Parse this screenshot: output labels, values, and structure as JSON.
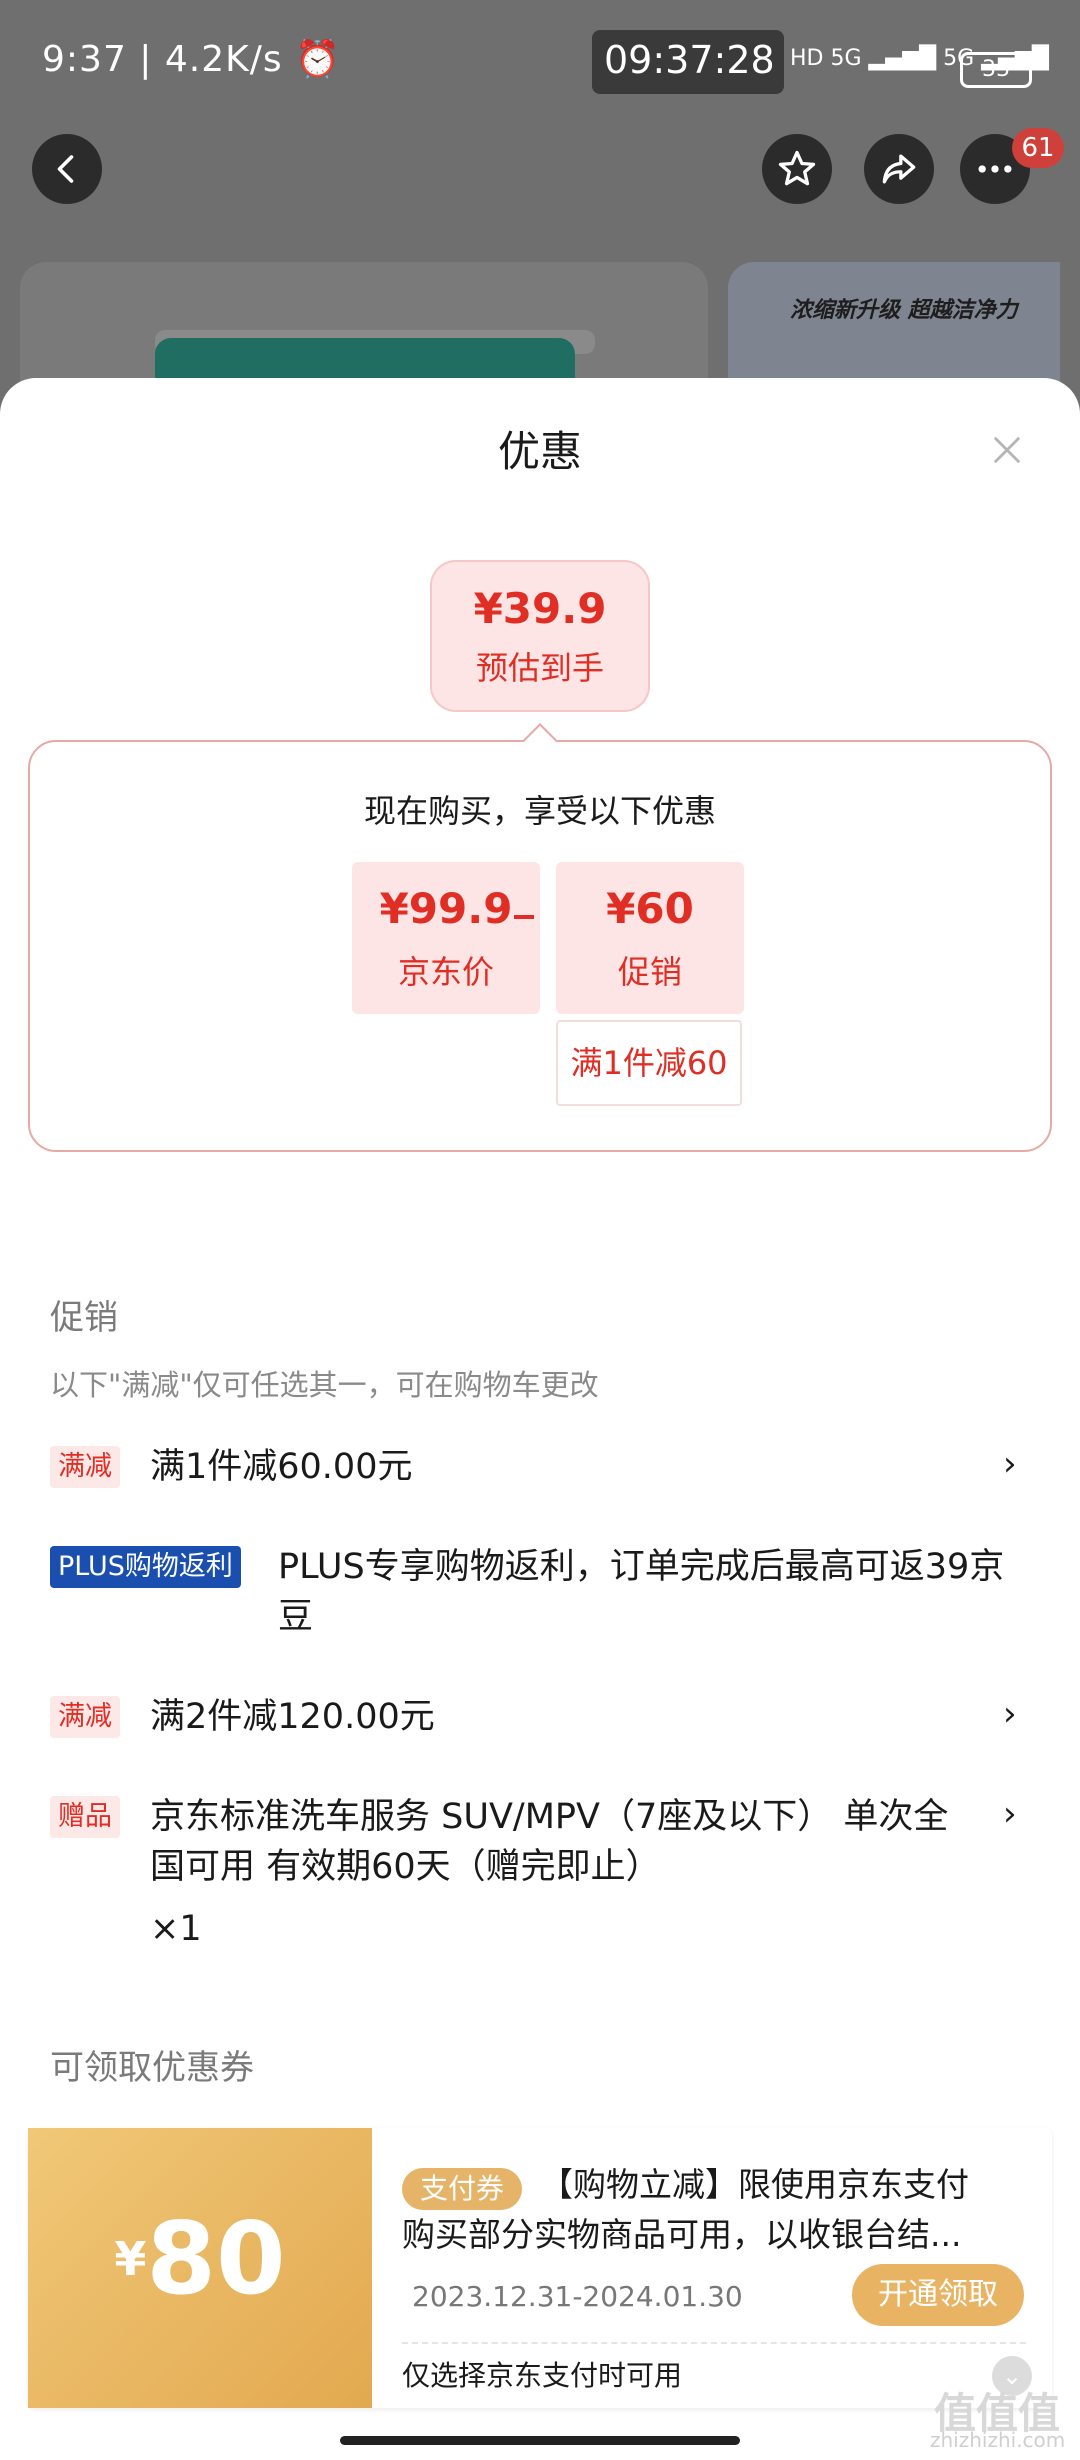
{
  "status_bar": {
    "left": "9:37 | 4.2K/s ⏰",
    "clock": "09:37:28",
    "signals": "HD  5G ▂▄▆█ 5G ▂▄▆█",
    "battery": "33"
  },
  "nav": {
    "notification_count": "61"
  },
  "background": {
    "banner_text": "浓缩新升级 超越洁净力"
  },
  "sheet": {
    "title": "优惠",
    "estimate": {
      "price": "¥39.9",
      "label": "预估到手"
    },
    "breakdown": {
      "heading": "现在购买，享受以下优惠",
      "jd_price": {
        "value": "¥99.9",
        "label": "京东价"
      },
      "promo": {
        "value": "¥60",
        "label": "促销"
      },
      "promo_rule": "满1件减60"
    },
    "promotions": {
      "title": "促销",
      "subtitle": "以下\"满减\"仅可任选其一，可在购物车更改",
      "items": [
        {
          "tag": "满减",
          "text": "满1件减60.00元"
        },
        {
          "tag": "PLUS购物返利",
          "text": "PLUS专享购物返利，订单完成后最高可返39京豆"
        },
        {
          "tag": "满减",
          "text": "满2件减120.00元"
        },
        {
          "tag": "赠品",
          "text": "京东标准洗车服务 SUV/MPV（7座及以下） 单次全国可用 有效期60天（赠完即止）",
          "qty": "×1"
        }
      ]
    },
    "coupons": {
      "title": "可领取优惠券",
      "items": [
        {
          "currency": "¥",
          "amount": "80",
          "tag": "支付券",
          "description": "【购物立减】限使用京东支付购买部分实物商品可用，以收银台结...",
          "date_range": "2023.12.31-2024.01.30",
          "button": "开通领取",
          "note": "仅选择京东支付时可用"
        }
      ]
    }
  },
  "watermark": {
    "main": "值值值",
    "sub": "zhizhizhi.com"
  }
}
